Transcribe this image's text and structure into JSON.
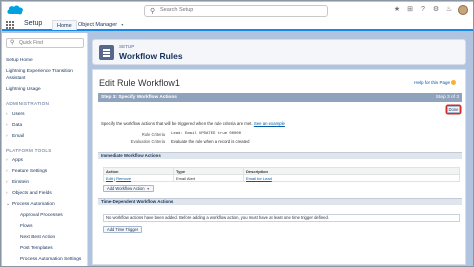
{
  "header": {
    "search_placeholder": "Search Setup",
    "icons": [
      "star-icon",
      "add-icon",
      "help-icon",
      "gear-icon",
      "bell-icon",
      "avatar"
    ]
  },
  "app_nav": {
    "app_name": "Setup",
    "tabs": [
      {
        "label": "Home",
        "active": true
      },
      {
        "label": "Object Manager",
        "active": false
      }
    ]
  },
  "sidebar": {
    "quick_find_placeholder": "Quick Find",
    "items": [
      "Setup Home",
      "Lightning Experience Transition",
      "Assistant",
      "Lightning Usage"
    ],
    "admin_heading": "ADMINISTRATION",
    "admin_items": [
      "Users",
      "Data",
      "Email"
    ],
    "platform_heading": "PLATFORM TOOLS",
    "platform_items": [
      "Apps",
      "Feature Settings",
      "Einstein",
      "Objects and Fields",
      "Process Automation"
    ],
    "process_children": [
      "Approval Processes",
      "Flows",
      "Next Best Action",
      "Post Templates",
      "Process Automation Settings"
    ]
  },
  "page_header": {
    "eyebrow": "SETUP",
    "title": "Workflow Rules"
  },
  "content": {
    "title": "Edit Rule Workflow1",
    "help_link": "Help for this Page",
    "step_title": "Step 3: Specify Workflow Actions",
    "step_count": "Step 3 of 3",
    "done_label": "Done",
    "description": "Specify the workflow actions that will be triggered when the rule criteria are met.",
    "see_example": "See an example",
    "rule_criteria_label": "Rule Criteria",
    "rule_criteria_value": "Lead: Email UPDATED  true  00000",
    "eval_criteria_label": "Evaluation Criteria",
    "eval_criteria_value": "Evaluate the rule when a record is created",
    "immediate_heading": "Immediate Workflow Actions",
    "table_headers": [
      "Action",
      "Type",
      "Description"
    ],
    "table_rows": [
      {
        "edit": "Edit",
        "sep": " | ",
        "remove": "Remove",
        "type": "Email Alert",
        "description": "Email for Lead"
      }
    ],
    "add_workflow_action": "Add Workflow Action",
    "time_dependent_heading": "Time-Dependent Workflow Actions",
    "time_dependent_info": "No workflow actions have been added. Before adding a workflow action, you must have at least one time trigger defined.",
    "add_time_trigger": "Add Time Trigger"
  },
  "colors": {
    "brand_blue": "#1589ee",
    "step_bar": "#8fa3bd",
    "highlight_red": "#d62b2b",
    "background": "#b0c4df"
  }
}
